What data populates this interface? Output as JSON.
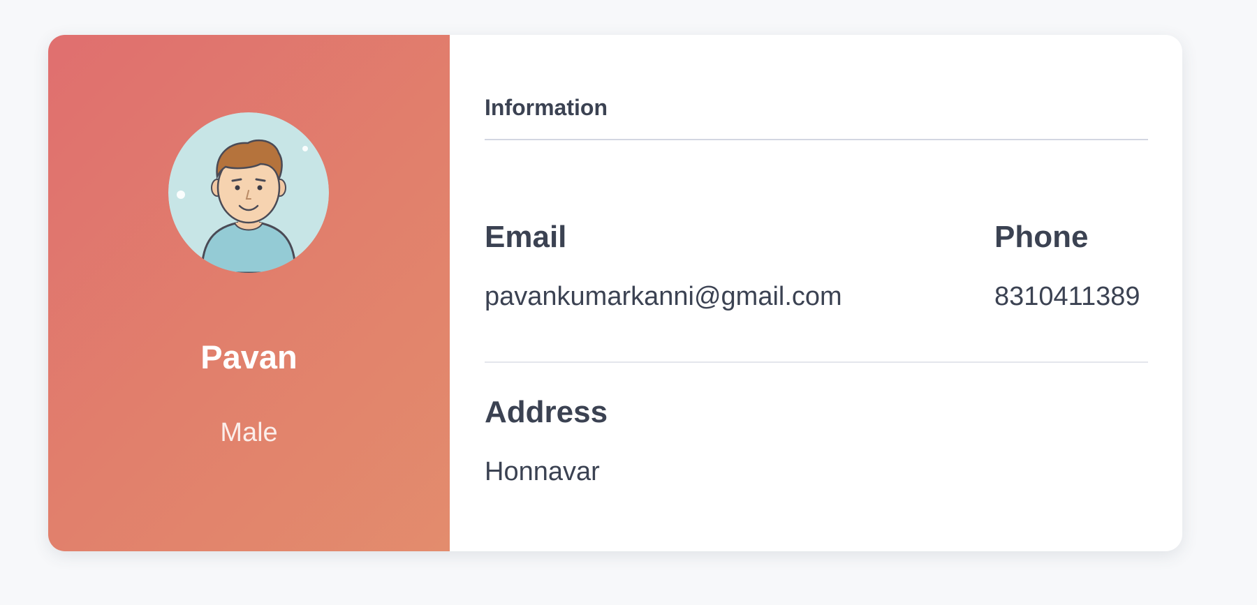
{
  "profile": {
    "name": "Pavan",
    "gender": "Male",
    "avatar_icon": "user-avatar-icon"
  },
  "info": {
    "section_title": "Information",
    "email_label": "Email",
    "email_value": "pavankumarkanni@gmail.com",
    "phone_label": "Phone",
    "phone_value": "8310411389",
    "address_label": "Address",
    "address_value": "Honnavar"
  },
  "colors": {
    "page_background": "#f7f8fa",
    "panel_gradient_start": "#e06f6f",
    "panel_gradient_end": "#e38c6d",
    "text_dark": "#3b4252",
    "avatar_background": "#c7e5e6"
  }
}
